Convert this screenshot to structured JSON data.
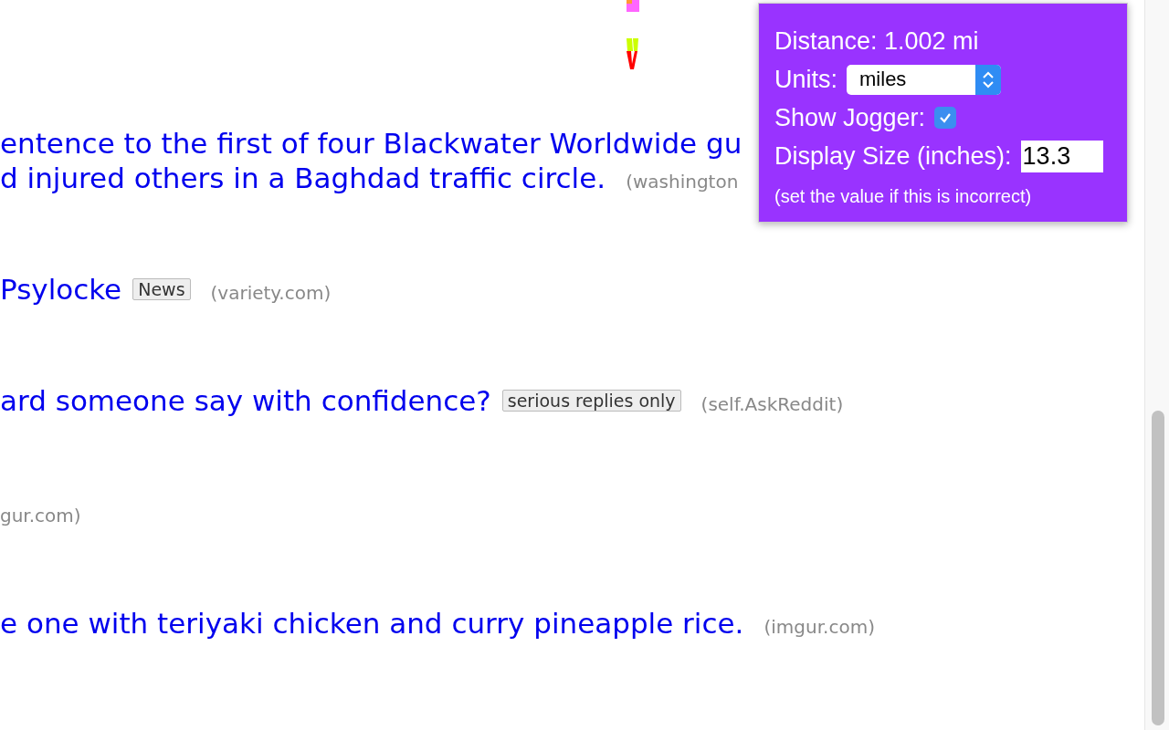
{
  "posts": [
    {
      "title_lines": [
        "entence to the first of four Blackwater Worldwide gu",
        "d injured others in a Baghdad traffic circle."
      ],
      "domain": "(washington"
    },
    {
      "title_lines": [
        "Psylocke"
      ],
      "tag": "News",
      "domain": "(variety.com)"
    },
    {
      "title_lines": [
        "ard someone say with confidence?"
      ],
      "tag": "serious replies only",
      "domain": "(self.AskReddit)"
    },
    {
      "domain": "gur.com)"
    },
    {
      "title_lines": [
        "e one with teriyaki chicken and curry pineapple rice."
      ],
      "domain": "(imgur.com)"
    }
  ],
  "popup": {
    "distance": "Distance: 1.002 mi",
    "units_label": "Units:",
    "units_value": "miles",
    "jogger_label": "Show Jogger:",
    "show_jogger": true,
    "size_label": "Display Size (inches):",
    "size_value": "13.3",
    "note": "(set the value if this is incorrect)"
  }
}
